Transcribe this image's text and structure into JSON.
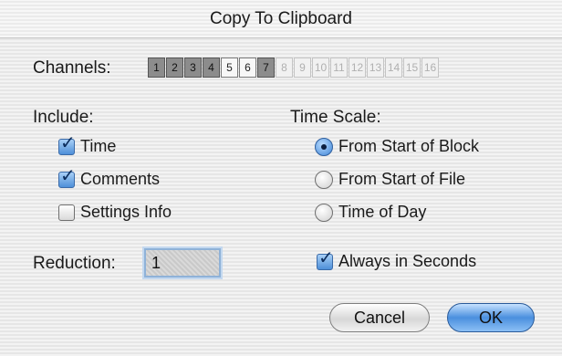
{
  "window": {
    "title": "Copy To Clipboard"
  },
  "channels": {
    "label": "Channels:",
    "items": [
      {
        "label": "1",
        "state": "on"
      },
      {
        "label": "2",
        "state": "on"
      },
      {
        "label": "3",
        "state": "on"
      },
      {
        "label": "4",
        "state": "on"
      },
      {
        "label": "5",
        "state": "off"
      },
      {
        "label": "6",
        "state": "off"
      },
      {
        "label": "7",
        "state": "on"
      },
      {
        "label": "8",
        "state": "disabled"
      },
      {
        "label": "9",
        "state": "disabled"
      },
      {
        "label": "10",
        "state": "disabled"
      },
      {
        "label": "11",
        "state": "disabled"
      },
      {
        "label": "12",
        "state": "disabled"
      },
      {
        "label": "13",
        "state": "disabled"
      },
      {
        "label": "14",
        "state": "disabled"
      },
      {
        "label": "15",
        "state": "disabled"
      },
      {
        "label": "16",
        "state": "disabled"
      }
    ]
  },
  "include": {
    "label": "Include:",
    "time": {
      "label": "Time",
      "checked": true
    },
    "comments": {
      "label": "Comments",
      "checked": true
    },
    "settings_info": {
      "label": "Settings Info",
      "checked": false
    }
  },
  "time_scale": {
    "label": "Time Scale:",
    "from_start_block": {
      "label": "From Start of Block",
      "selected": true
    },
    "from_start_file": {
      "label": "From Start of File",
      "selected": false
    },
    "time_of_day": {
      "label": "Time of Day",
      "selected": false
    }
  },
  "reduction": {
    "label": "Reduction:",
    "value": "1"
  },
  "always_seconds": {
    "label": "Always in Seconds",
    "checked": true
  },
  "buttons": {
    "cancel": "Cancel",
    "ok": "OK"
  },
  "colors": {
    "accent": "#4a8fde",
    "channel_on": "#8c8c8c"
  }
}
